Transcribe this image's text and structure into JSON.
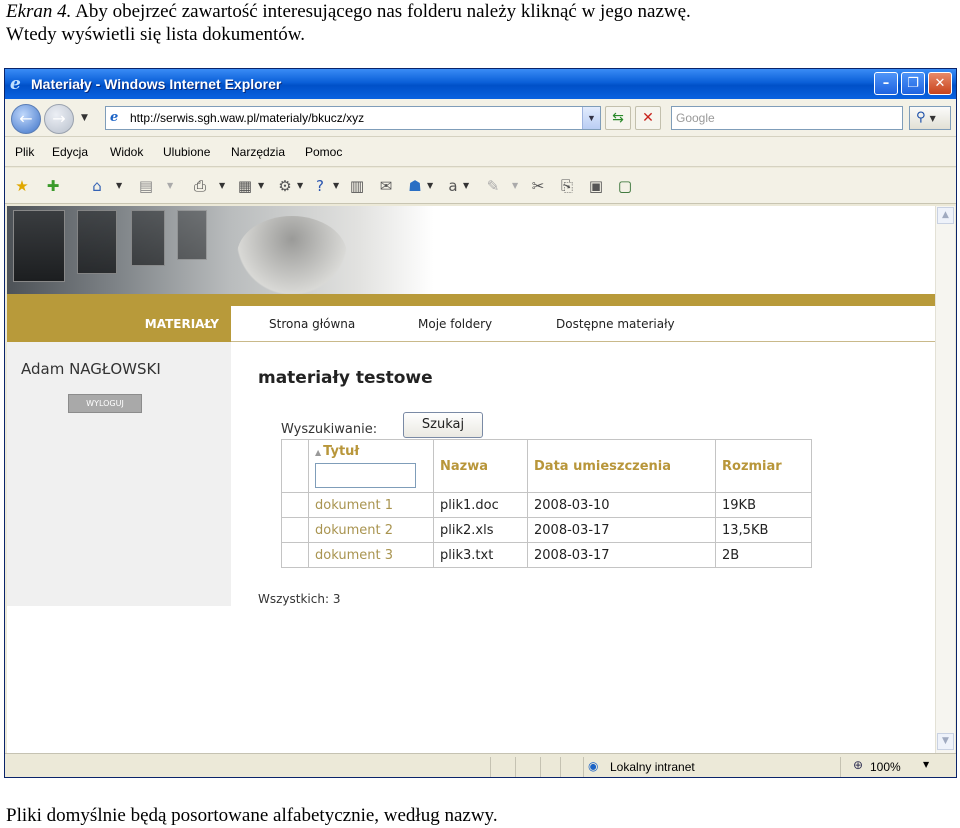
{
  "caption": {
    "label": "Ekran 4.",
    "line1": "Aby obejrzeć zawartość interesującego nas folderu należy kliknąć w jego nazwę.",
    "line2": "Wtedy wyświetli się lista dokumentów."
  },
  "footer": "Pliki domyślnie będą posortowane alfabetycznie, według nazwy.",
  "browser": {
    "title": "Materiały - Windows Internet Explorer",
    "url": "http://serwis.sgh.waw.pl/materialy/bkucz/xyz",
    "search_placeholder": "Google",
    "menu": [
      "Plik",
      "Edycja",
      "Widok",
      "Ulubione",
      "Narzędzia",
      "Pomoc"
    ],
    "status_zone": "Lokalny intranet",
    "zoom": "100%"
  },
  "site": {
    "nav_active": "MATERIAŁY",
    "nav": [
      "Strona główna",
      "Moje foldery",
      "Dostępne materiały"
    ],
    "user_name": "Adam NAGŁOWSKI",
    "logout_label": "WYLOGUJ",
    "page_title": "materiały testowe",
    "search_label": "Wyszukiwanie:",
    "search_button": "Szukaj",
    "columns": [
      "Tytuł",
      "Nazwa",
      "Data umieszczenia",
      "Rozmiar"
    ],
    "rows": [
      {
        "title": "dokument 1",
        "name": "plik1.doc",
        "date": "2008-03-10",
        "size": "19KB"
      },
      {
        "title": "dokument 2",
        "name": "plik2.xls",
        "date": "2008-03-17",
        "size": "13,5KB"
      },
      {
        "title": "dokument 3",
        "name": "plik3.txt",
        "date": "2008-03-17",
        "size": "2B"
      }
    ],
    "total": "Wszystkich: 3"
  }
}
